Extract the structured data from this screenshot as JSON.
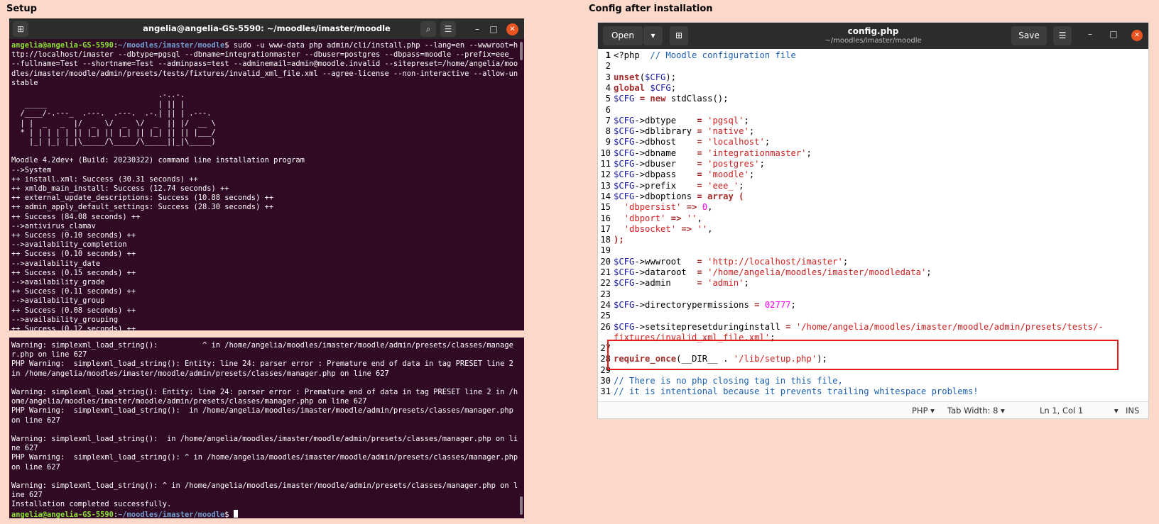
{
  "left_title": "Setup",
  "right_title": "Config after installation",
  "terminal1": {
    "title": "angelia@angelia-GS-5590: ~/moodles/imaster/moodle",
    "prompt_user": "angelia@angelia-GS-5590",
    "prompt_path": "~/moodles/imaster/moodle",
    "command": "$ sudo -u www-data php admin/cli/install.php --lang=en --wwwroot=http://localhost/imaster --dbtype=pgsql --dbname=integrationmaster --dbuser=postgres --dbpass=moodle --prefix=eee_ --fullname=Test --shortname=Test --adminpass=test --adminemail=admin@moodle.invalid --sitepreset=/home/angelia/moodles/imaster/moodle/admin/presets/tests/fixtures/invalid_xml_file.xml --agree-license --non-interactive --allow-unstable",
    "ascii_art": "                                 .-..-.\n   _____                         | || |\n  /____/-.---_  .---.  .---.  .-.| || | .---.\n  | |  _   _  |/  _  \\/  _  \\/  _  || |/  __ \\\n  * | | | | | || |_| || |_| || |_| || || |___/\n    |_| |_| |_|\\_____/\\_____/\\_____||_|\\_____)",
    "output": "Moodle 4.2dev+ (Build: 20230322) command line installation program\n-->System\n++ install.xml: Success (30.31 seconds) ++\n++ xmldb_main_install: Success (12.74 seconds) ++\n++ external_update_descriptions: Success (10.88 seconds) ++\n++ admin_apply_default_settings: Success (28.30 seconds) ++\n++ Success (84.08 seconds) ++\n-->antivirus_clamav\n++ Success (0.10 seconds) ++\n-->availability_completion\n++ Success (0.10 seconds) ++\n-->availability_date\n++ Success (0.15 seconds) ++\n-->availability_grade\n++ Success (0.11 seconds) ++\n-->availability_group\n++ Success (0.08 seconds) ++\n-->availability_grouping\n++ Success (0.12 seconds) ++"
  },
  "terminal2": {
    "output": "Warning: simplexml_load_string():          ^ in /home/angelia/moodles/imaster/moodle/admin/presets/classes/manager.php on line 627\nPHP Warning:  simplexml_load_string(): Entity: line 24: parser error : Premature end of data in tag PRESET line 2 in /home/angelia/moodles/imaster/moodle/admin/presets/classes/manager.php on line 627\n\nWarning: simplexml_load_string(): Entity: line 24: parser error : Premature end of data in tag PRESET line 2 in /home/angelia/moodles/imaster/moodle/admin/presets/classes/manager.php on line 627\nPHP Warning:  simplexml_load_string():  in /home/angelia/moodles/imaster/moodle/admin/presets/classes/manager.php on line 627\n\nWarning: simplexml_load_string():  in /home/angelia/moodles/imaster/moodle/admin/presets/classes/manager.php on line 627\nPHP Warning:  simplexml_load_string(): ^ in /home/angelia/moodles/imaster/moodle/admin/presets/classes/manager.php on line 627\n\nWarning: simplexml_load_string(): ^ in /home/angelia/moodles/imaster/moodle/admin/presets/classes/manager.php on line 627\nInstallation completed successfully.",
    "prompt_user": "angelia@angelia-GS-5590",
    "prompt_path": "~/moodles/imaster/moodle",
    "prompt_suffix": "$ "
  },
  "gedit": {
    "open_label": "Open",
    "save_label": "Save",
    "filename": "config.php",
    "filepath": "~/moodles/imaster/moodle",
    "status_lang": "PHP",
    "status_tab": "Tab Width: 8",
    "status_pos": "Ln 1, Col 1",
    "status_mode": "INS",
    "lines": [
      "1",
      "2",
      "3",
      "4",
      "5",
      "6",
      "7",
      "8",
      "9",
      "10",
      "11",
      "12",
      "13",
      "14",
      "15",
      "16",
      "17",
      "18",
      "19",
      "20",
      "21",
      "22",
      "23",
      "24",
      "25",
      "26",
      "",
      "27",
      "28",
      "29",
      "30",
      "31"
    ]
  },
  "code": {
    "l1_open": "<?php",
    "l1_comment": "  // Moodle configuration file",
    "l3": "unset",
    "l3_var": "$CFG",
    "l4_kw": "global",
    "l4_var": "$CFG",
    "l5_var": "$CFG",
    "l5_new": "new",
    "l5_cls": "stdClass();",
    "cfg": "$CFG",
    "arrow": "->",
    "p_dbtype": "dbtype    ",
    "v_dbtype": "'pgsql'",
    "p_dblibrary": "dblibrary ",
    "v_dblibrary": "'native'",
    "p_dbhost": "dbhost    ",
    "v_dbhost": "'localhost'",
    "p_dbname": "dbname    ",
    "v_dbname": "'integrationmaster'",
    "p_dbuser": "dbuser    ",
    "v_dbuser": "'postgres'",
    "p_dbpass": "dbpass    ",
    "v_dbpass": "'moodle'",
    "p_prefix": "prefix    ",
    "v_prefix": "'eee_'",
    "p_dboptions": "dboptions ",
    "kw_array": "array",
    "k_dbpersist": "'dbpersist'",
    "v_dbpersist": "0",
    "k_dbport": "'dbport'",
    "v_dbport": "''",
    "k_dbsocket": "'dbsocket'",
    "v_dbsocket": "''",
    "close_paren": ");",
    "p_wwwroot": "wwwroot   ",
    "v_wwwroot": "'http://localhost/imaster'",
    "p_dataroot": "dataroot  ",
    "v_dataroot": "'/home/angelia/moodles/imaster/moodledata'",
    "p_admin": "admin     ",
    "v_admin": "'admin'",
    "p_dirperm": "directorypermissions",
    "v_dirperm": "02777",
    "p_sitepreset": "setsitepresetduringinstall",
    "v_sitepreset_1": "'/home/angelia/moodles/imaster/moodle/admin/presets/tests/-",
    "v_sitepreset_2": "fixtures/invalid_xml_file.xml'",
    "require": "require_once",
    "dir": "(__DIR__ . ",
    "v_setup": "'/lib/setup.php'",
    "l30": "// There is no php closing tag in this file,",
    "l31": "// it is intentional because it prevents trailing whitespace problems!"
  }
}
